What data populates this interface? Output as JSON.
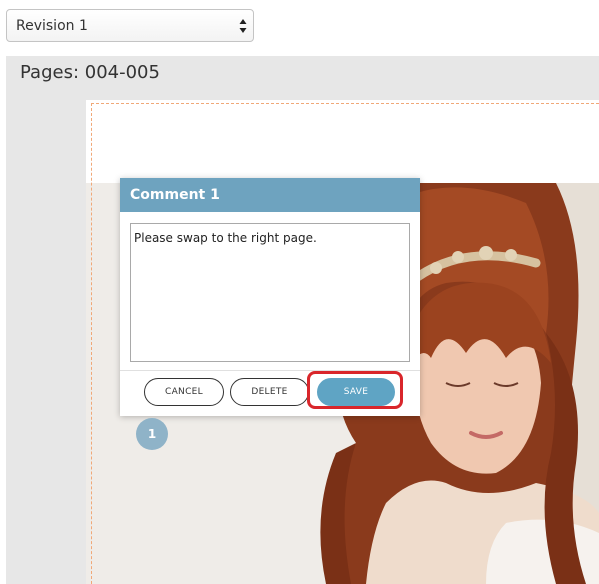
{
  "revision_select": {
    "value": "Revision 1"
  },
  "pages_label": "Pages: 004-005",
  "comment": {
    "title": "Comment 1",
    "text": "Please swap to the right page.",
    "buttons": {
      "cancel": "CANCEL",
      "delete": "DELETE",
      "save": "SAVE"
    }
  },
  "marker_number": "1",
  "colors": {
    "header": "#6ea3bf",
    "save_button": "#5fa4c4",
    "highlight": "#d9262b",
    "guide_dashes": "#f0a878",
    "marker": "#8fb3c8"
  }
}
